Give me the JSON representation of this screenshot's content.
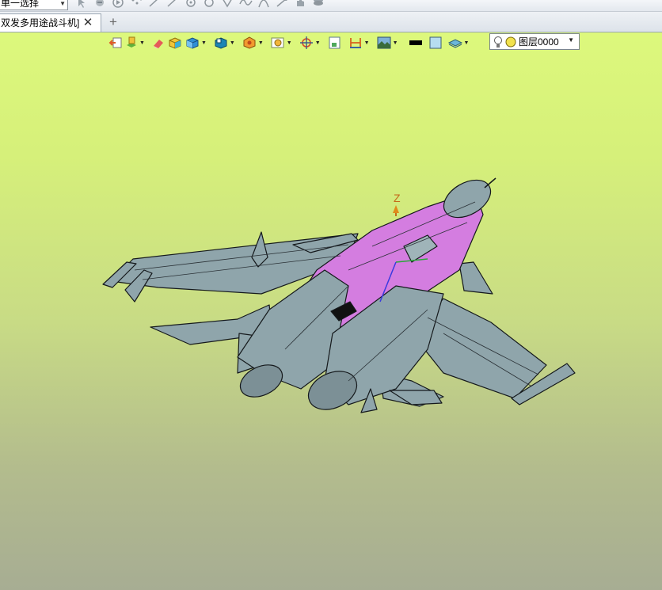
{
  "selection_filter": {
    "value": "单一选择"
  },
  "tabs": [
    {
      "label": "双发多用途战斗机]"
    }
  ],
  "view_toolbar": {
    "layer_select": {
      "value": "图层0000"
    }
  },
  "triad": {
    "z_label": "Z"
  },
  "colors": {
    "viewport_top": "#ddf87c",
    "viewport_bottom": "#a7ad93",
    "model_body": "#8fa5ab",
    "model_highlight": "#d47de0"
  }
}
